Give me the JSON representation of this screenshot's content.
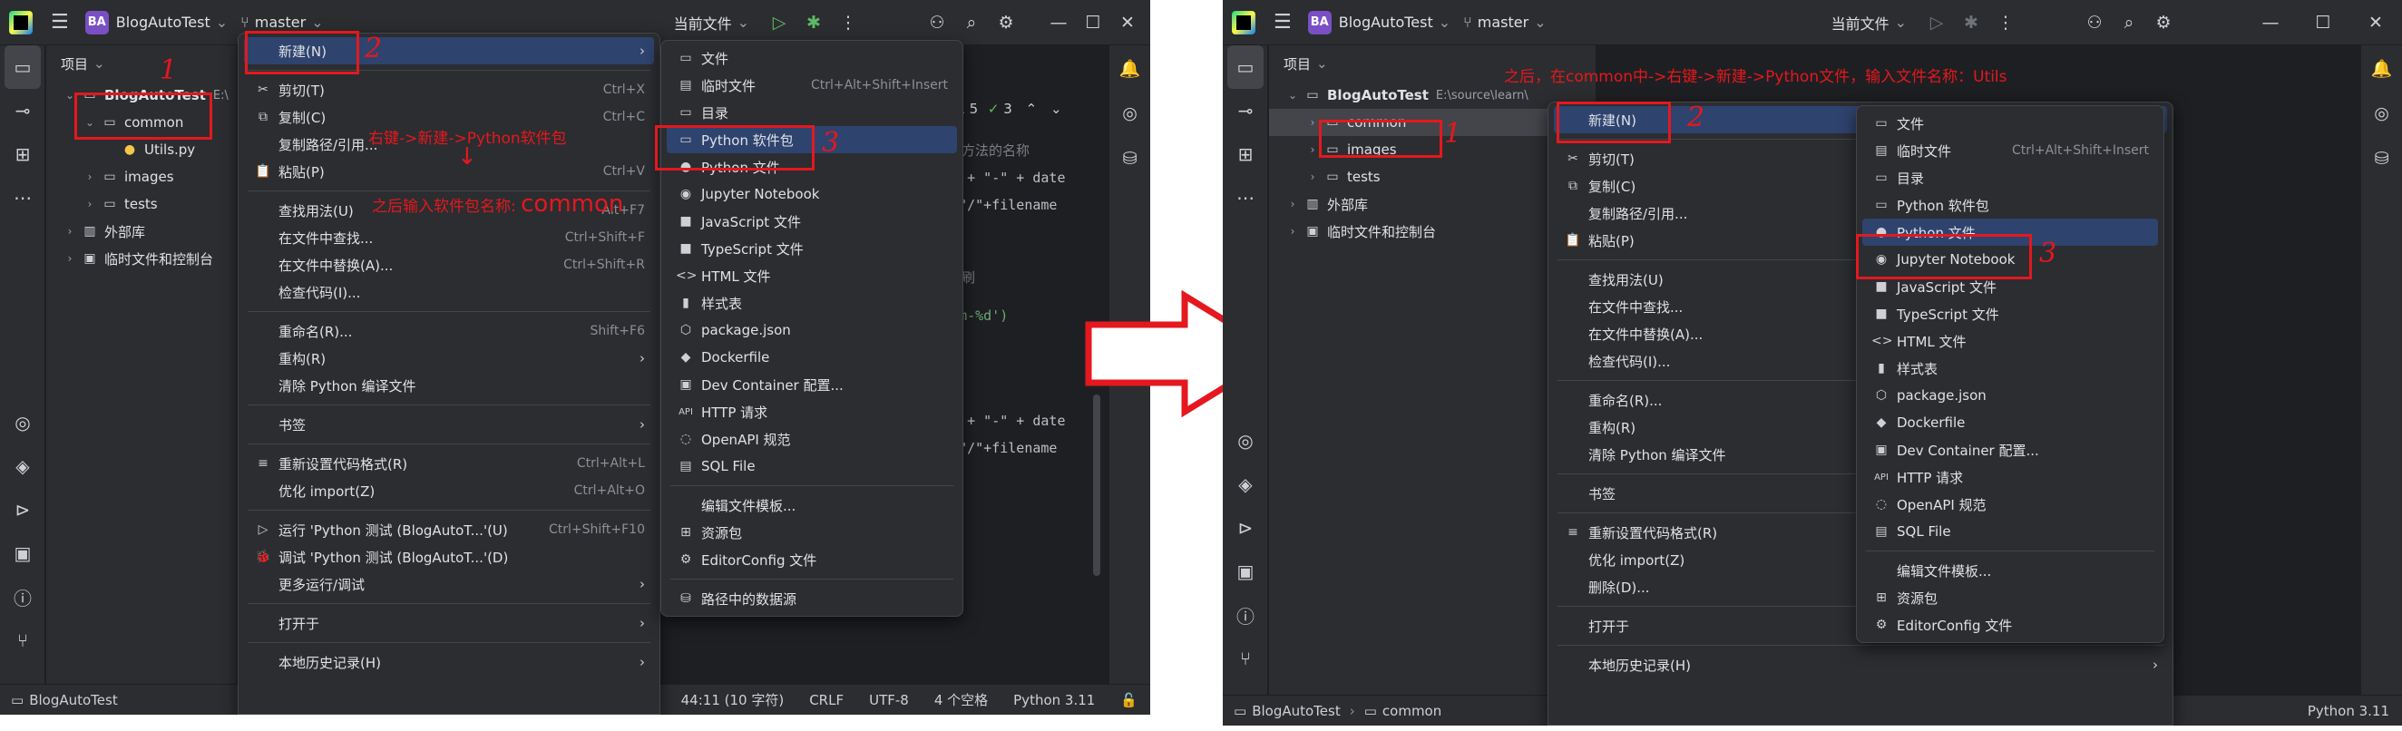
{
  "left": {
    "title": {
      "badge": "BA",
      "project": "BlogAutoTest",
      "branch": "master",
      "run_target": "当前文件"
    },
    "panel": {
      "header": "项目"
    },
    "tree": [
      {
        "label": "BlogAutoTest",
        "muted": "E:\\",
        "level": 0,
        "expanded": true,
        "kind": "project"
      },
      {
        "label": "common",
        "level": 1,
        "expanded": true,
        "kind": "folder"
      },
      {
        "label": "Utils.py",
        "level": 2,
        "kind": "py"
      },
      {
        "label": "images",
        "level": 1,
        "kind": "folder"
      },
      {
        "label": "tests",
        "level": 1,
        "kind": "folder"
      },
      {
        "label": "外部库",
        "level": 0,
        "kind": "lib"
      },
      {
        "label": "临时文件和控制台",
        "level": 0,
        "kind": "console"
      }
    ],
    "editor_toolbar": {
      "warnings": "4",
      "weak_warnings": "5",
      "typos": "3"
    },
    "code": [
      {
        "text": "调用方法的名称",
        "color": "#7a7e85"
      },
      {
        "text": "ame + \"-\" + date",
        "color": "#bcbec4"
      },
      {
        "text": "me+\"/\"+filename",
        "color": "#bcbec4"
      },
      {
        "text": "来印刷",
        "color": "#7a7e85"
      },
      {
        "text": "Y-%m-%d')",
        "color": "#6aab73"
      },
      {
        "text": "ame + \"-\" + date",
        "color": "#bcbec4"
      },
      {
        "text": "me+\"/\"+filename",
        "color": "#bcbec4"
      }
    ],
    "status": {
      "project": "BlogAutoTest",
      "position": "44:11 (10 字符)",
      "line_sep": "CRLF",
      "encoding": "UTF-8",
      "indent": "4 个空格",
      "interpreter": "Python 3.11"
    },
    "context_menu": [
      {
        "label": "新建(N)",
        "submenu": true,
        "highlight": true
      },
      {
        "sep": true
      },
      {
        "label": "剪切(T)",
        "shortcut": "Ctrl+X",
        "icon": "✂"
      },
      {
        "label": "复制(C)",
        "shortcut": "Ctrl+C",
        "icon": "⧉"
      },
      {
        "label": "复制路径/引用...",
        "shortcut": ""
      },
      {
        "label": "粘贴(P)",
        "shortcut": "Ctrl+V",
        "icon": "📋"
      },
      {
        "sep": true
      },
      {
        "label": "查找用法(U)",
        "shortcut": "Alt+F7"
      },
      {
        "label": "在文件中查找...",
        "shortcut": "Ctrl+Shift+F"
      },
      {
        "label": "在文件中替换(A)...",
        "shortcut": "Ctrl+Shift+R"
      },
      {
        "label": "检查代码(I)..."
      },
      {
        "sep": true
      },
      {
        "label": "重命名(R)...",
        "shortcut": "Shift+F6"
      },
      {
        "label": "重构(R)",
        "submenu": true
      },
      {
        "label": "清除 Python 编译文件"
      },
      {
        "sep": true
      },
      {
        "label": "书签",
        "submenu": true
      },
      {
        "sep": true
      },
      {
        "label": "重新设置代码格式(R)",
        "shortcut": "Ctrl+Alt+L",
        "icon": "≡"
      },
      {
        "label": "优化 import(Z)",
        "shortcut": "Ctrl+Alt+O"
      },
      {
        "sep": true
      },
      {
        "label": "运行 'Python 测试 (BlogAutoT...'(U)",
        "shortcut": "Ctrl+Shift+F10",
        "icon": "▷"
      },
      {
        "label": "调试 'Python 测试 (BlogAutoT...'(D)",
        "icon": "🐞"
      },
      {
        "label": "更多运行/调试",
        "submenu": true
      },
      {
        "sep": true
      },
      {
        "label": "打开于",
        "submenu": true
      },
      {
        "sep": true
      },
      {
        "label": "本地历史记录(H)",
        "submenu": true
      }
    ],
    "new_submenu": [
      {
        "label": "文件",
        "shortcut": "",
        "icon": "▭"
      },
      {
        "label": "临时文件",
        "shortcut": "Ctrl+Alt+Shift+Insert",
        "icon": "▤"
      },
      {
        "label": "目录",
        "icon": "▭"
      },
      {
        "label": "Python 软件包",
        "icon": "▭",
        "highlight": true
      },
      {
        "label": "Python 文件",
        "icon": "●",
        "cls": "ico-py"
      },
      {
        "label": "Jupyter Notebook",
        "icon": "◉",
        "cls": "ico-orange"
      },
      {
        "label": "JavaScript 文件",
        "icon": "■",
        "cls": "ico-py"
      },
      {
        "label": "TypeScript 文件",
        "icon": "■",
        "cls": "ico-blue"
      },
      {
        "label": "HTML 文件",
        "icon": "<>",
        "cls": "ico-green"
      },
      {
        "label": "样式表",
        "icon": "▮",
        "cls": "ico-blue"
      },
      {
        "label": "package.json",
        "icon": "⬡",
        "cls": "ico-green"
      },
      {
        "label": "Dockerfile",
        "icon": "◆",
        "cls": "ico-blue"
      },
      {
        "label": "Dev Container 配置...",
        "icon": "▣",
        "cls": "ico-blue"
      },
      {
        "label": "HTTP 请求",
        "icon": "API",
        "cls": "ico-blue"
      },
      {
        "label": "OpenAPI 规范",
        "icon": "◌",
        "cls": "ico-green"
      },
      {
        "label": "SQL File",
        "icon": "▤",
        "cls": "ico-blue"
      },
      {
        "sep": true
      },
      {
        "label": "编辑文件模板..."
      },
      {
        "label": "资源包",
        "icon": "⊞"
      },
      {
        "label": "EditorConfig 文件",
        "icon": "⚙"
      },
      {
        "sep": true
      },
      {
        "label": "路径中的数据源",
        "icon": "⛁"
      }
    ],
    "annotations": {
      "n1": "1",
      "n2": "2",
      "n3": "3",
      "step": "右键->新建->Python软件包",
      "then": "之后输入软件包名称:",
      "name": "common"
    }
  },
  "right": {
    "title": {
      "badge": "BA",
      "project": "BlogAutoTest",
      "branch": "master",
      "run_target": "当前文件"
    },
    "panel": {
      "header": "项目"
    },
    "tree": [
      {
        "label": "BlogAutoTest",
        "muted": "E:\\source\\learn\\",
        "level": 0,
        "expanded": true,
        "kind": "project"
      },
      {
        "label": "common",
        "level": 1,
        "kind": "folder",
        "selected": true
      },
      {
        "label": "images",
        "level": 1,
        "kind": "folder"
      },
      {
        "label": "tests",
        "level": 1,
        "kind": "folder"
      },
      {
        "label": "外部库",
        "level": 0,
        "kind": "lib"
      },
      {
        "label": "临时文件和控制台",
        "level": 0,
        "kind": "console"
      }
    ],
    "status": {
      "project": "BlogAutoTest",
      "folder": "common",
      "interpreter": "Python 3.11"
    },
    "context_menu": [
      {
        "label": "新建(N)",
        "submenu": true,
        "highlight": true
      },
      {
        "sep": true
      },
      {
        "label": "剪切(T)",
        "shortcut": "Ctrl+X",
        "icon": "✂"
      },
      {
        "label": "复制(C)",
        "shortcut": "Ctrl+C",
        "icon": "⧉"
      },
      {
        "label": "复制路径/引用..."
      },
      {
        "label": "粘贴(P)",
        "shortcut": "Ctrl+V",
        "icon": "📋"
      },
      {
        "sep": true
      },
      {
        "label": "查找用法(U)",
        "shortcut": "Alt+F7"
      },
      {
        "label": "在文件中查找...",
        "shortcut": "Ctrl+Shift+F"
      },
      {
        "label": "在文件中替换(A)...",
        "shortcut": "Ctrl+Shift+R"
      },
      {
        "label": "检查代码(I)..."
      },
      {
        "sep": true
      },
      {
        "label": "重命名(R)...",
        "shortcut": "Shift+F6"
      },
      {
        "label": "重构(R)",
        "submenu": true
      },
      {
        "label": "清除 Python 编译文件"
      },
      {
        "sep": true
      },
      {
        "label": "书签",
        "submenu": true
      },
      {
        "sep": true
      },
      {
        "label": "重新设置代码格式(R)",
        "shortcut": "Ctrl+Alt+L",
        "icon": "≡"
      },
      {
        "label": "优化 import(Z)",
        "shortcut": "Ctrl+Alt+O"
      },
      {
        "label": "删除(D)...",
        "shortcut": "Delete"
      },
      {
        "sep": true
      },
      {
        "label": "打开于",
        "submenu": true
      },
      {
        "sep": true
      },
      {
        "label": "本地历史记录(H)",
        "submenu": true
      }
    ],
    "new_submenu": [
      {
        "label": "文件",
        "icon": "▭"
      },
      {
        "label": "临时文件",
        "shortcut": "Ctrl+Alt+Shift+Insert",
        "icon": "▤"
      },
      {
        "label": "目录",
        "icon": "▭"
      },
      {
        "label": "Python 软件包",
        "icon": "▭"
      },
      {
        "label": "Python 文件",
        "icon": "●",
        "cls": "ico-py",
        "highlight": true
      },
      {
        "label": "Jupyter Notebook",
        "icon": "◉",
        "cls": "ico-orange"
      },
      {
        "label": "JavaScript 文件",
        "icon": "■",
        "cls": "ico-py"
      },
      {
        "label": "TypeScript 文件",
        "icon": "■",
        "cls": "ico-blue"
      },
      {
        "label": "HTML 文件",
        "icon": "<>",
        "cls": "ico-green"
      },
      {
        "label": "样式表",
        "icon": "▮",
        "cls": "ico-blue"
      },
      {
        "label": "package.json",
        "icon": "⬡",
        "cls": "ico-green"
      },
      {
        "label": "Dockerfile",
        "icon": "◆",
        "cls": "ico-blue"
      },
      {
        "label": "Dev Container 配置...",
        "icon": "▣",
        "cls": "ico-blue"
      },
      {
        "label": "HTTP 请求",
        "icon": "API",
        "cls": "ico-blue"
      },
      {
        "label": "OpenAPI 规范",
        "icon": "◌",
        "cls": "ico-green"
      },
      {
        "label": "SQL File",
        "icon": "▤",
        "cls": "ico-blue"
      },
      {
        "sep": true
      },
      {
        "label": "编辑文件模板..."
      },
      {
        "label": "资源包",
        "icon": "⊞"
      },
      {
        "label": "EditorConfig 文件",
        "icon": "⚙"
      }
    ],
    "annotations": {
      "n1": "1",
      "n2": "2",
      "n3": "3",
      "step": "之后，在common中->右键->新建->Python文件，输入文件名称：Utils"
    }
  },
  "colors": {
    "accent": "#2e436e",
    "annotation": "#e4181e",
    "bg": "#1e1f22",
    "panel": "#2b2d30"
  }
}
